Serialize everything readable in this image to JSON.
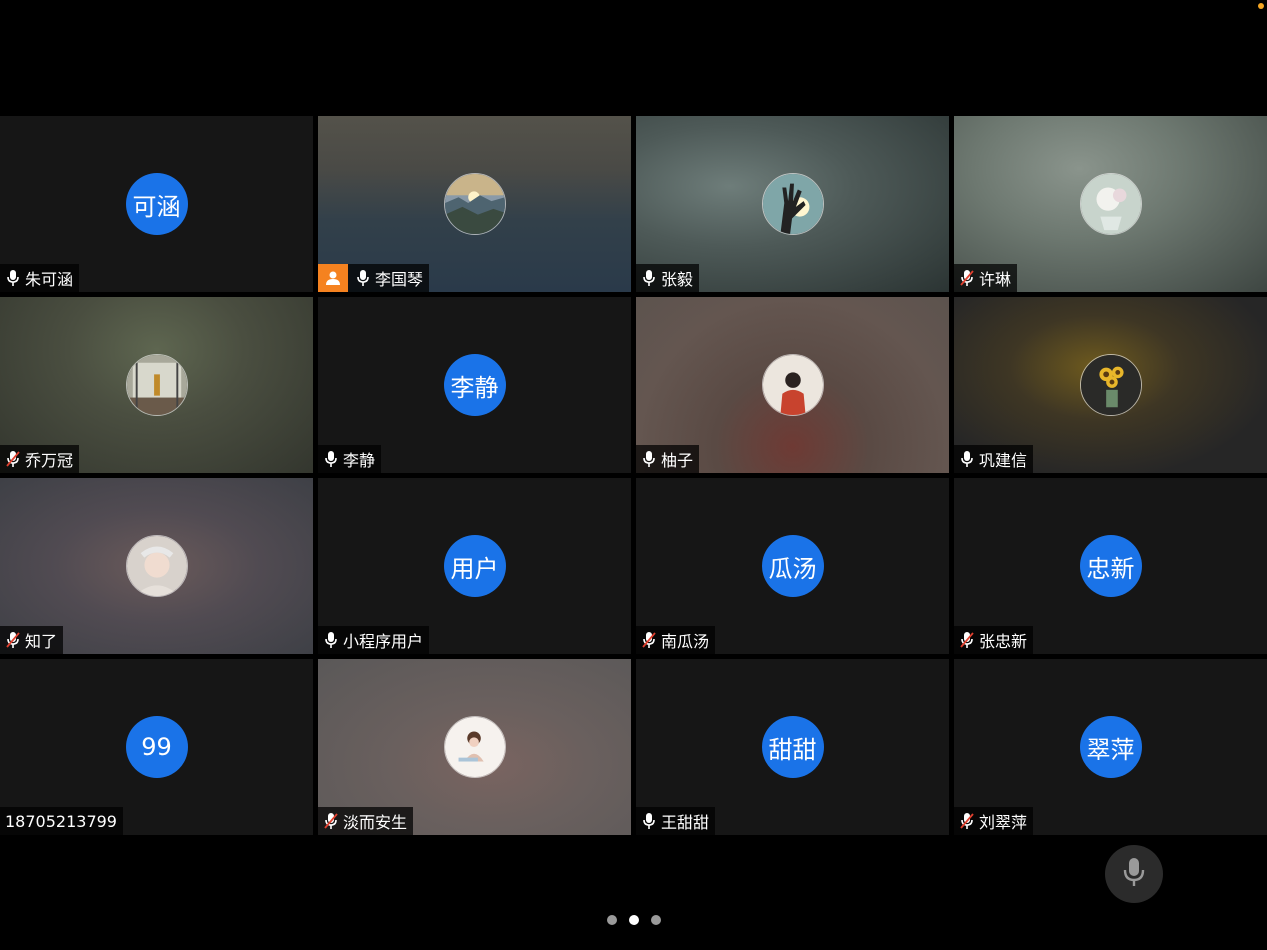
{
  "participants": [
    {
      "name": "朱可涵",
      "avatar_text": "可涵",
      "mic": "on"
    },
    {
      "name": "李国琴",
      "avatar_text": "",
      "mic": "on",
      "host": true,
      "active": true
    },
    {
      "name": "张毅",
      "avatar_text": "",
      "mic": "on"
    },
    {
      "name": "许琳",
      "avatar_text": "",
      "mic": "muted"
    },
    {
      "name": "乔万冠",
      "avatar_text": "",
      "mic": "muted"
    },
    {
      "name": "李静",
      "avatar_text": "李静",
      "mic": "on"
    },
    {
      "name": "柚子",
      "avatar_text": "",
      "mic": "on"
    },
    {
      "name": "巩建信",
      "avatar_text": "",
      "mic": "on"
    },
    {
      "name": "知了",
      "avatar_text": "",
      "mic": "muted"
    },
    {
      "name": "小程序用户",
      "avatar_text": "用户",
      "mic": "on"
    },
    {
      "name": "南瓜汤",
      "avatar_text": "瓜汤",
      "mic": "muted"
    },
    {
      "name": "张忠新",
      "avatar_text": "忠新",
      "mic": "muted"
    },
    {
      "name": "18705213799",
      "avatar_text": "99",
      "mic": "none"
    },
    {
      "name": "淡而安生",
      "avatar_text": "",
      "mic": "muted"
    },
    {
      "name": "王甜甜",
      "avatar_text": "甜甜",
      "mic": "on"
    },
    {
      "name": "刘翠萍",
      "avatar_text": "翠萍",
      "mic": "muted"
    }
  ],
  "pagination": {
    "total": 3,
    "current": 2
  },
  "colors": {
    "avatar_blue": "#1a73e8",
    "active_border": "#1fbf5e",
    "host_badge": "#f58220",
    "muted_red": "#e0402f"
  },
  "icons": {
    "mic_on": "microphone-icon",
    "mic_muted": "microphone-muted-icon",
    "host": "host-person-icon"
  }
}
